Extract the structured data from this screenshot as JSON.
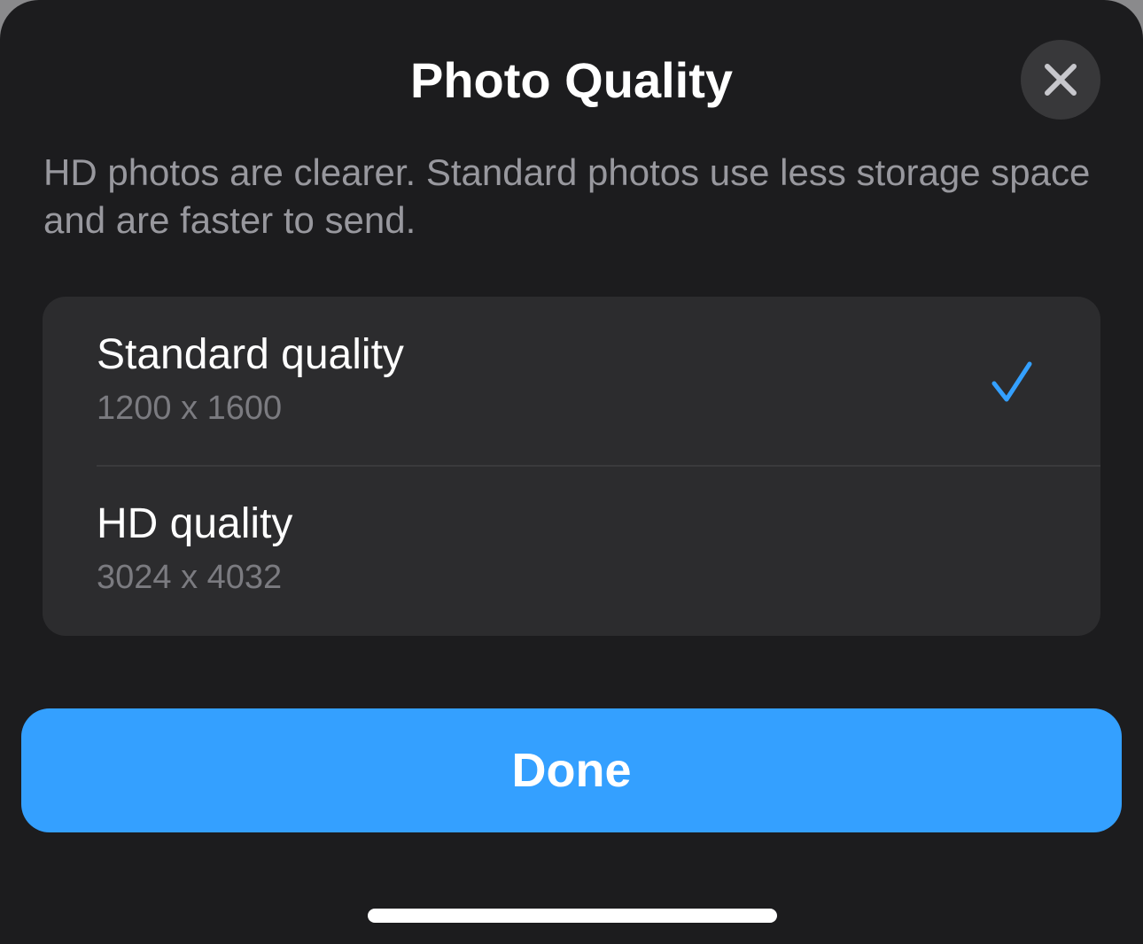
{
  "sheet": {
    "title": "Photo Quality",
    "close_icon": "close-icon",
    "description": "HD photos are clearer. Standard photos use less storage space and are faster to send."
  },
  "options": [
    {
      "label": "Standard quality",
      "resolution": "1200 x 1600",
      "selected": true
    },
    {
      "label": "HD quality",
      "resolution": "3024 x 4032",
      "selected": false
    }
  ],
  "done": {
    "label": "Done"
  },
  "colors": {
    "sheet_bg": "#1c1c1e",
    "group_bg": "#2c2c2e",
    "accent": "#34a0ff",
    "secondary_text": "#98989e",
    "tertiary_text": "#7b7b80"
  }
}
